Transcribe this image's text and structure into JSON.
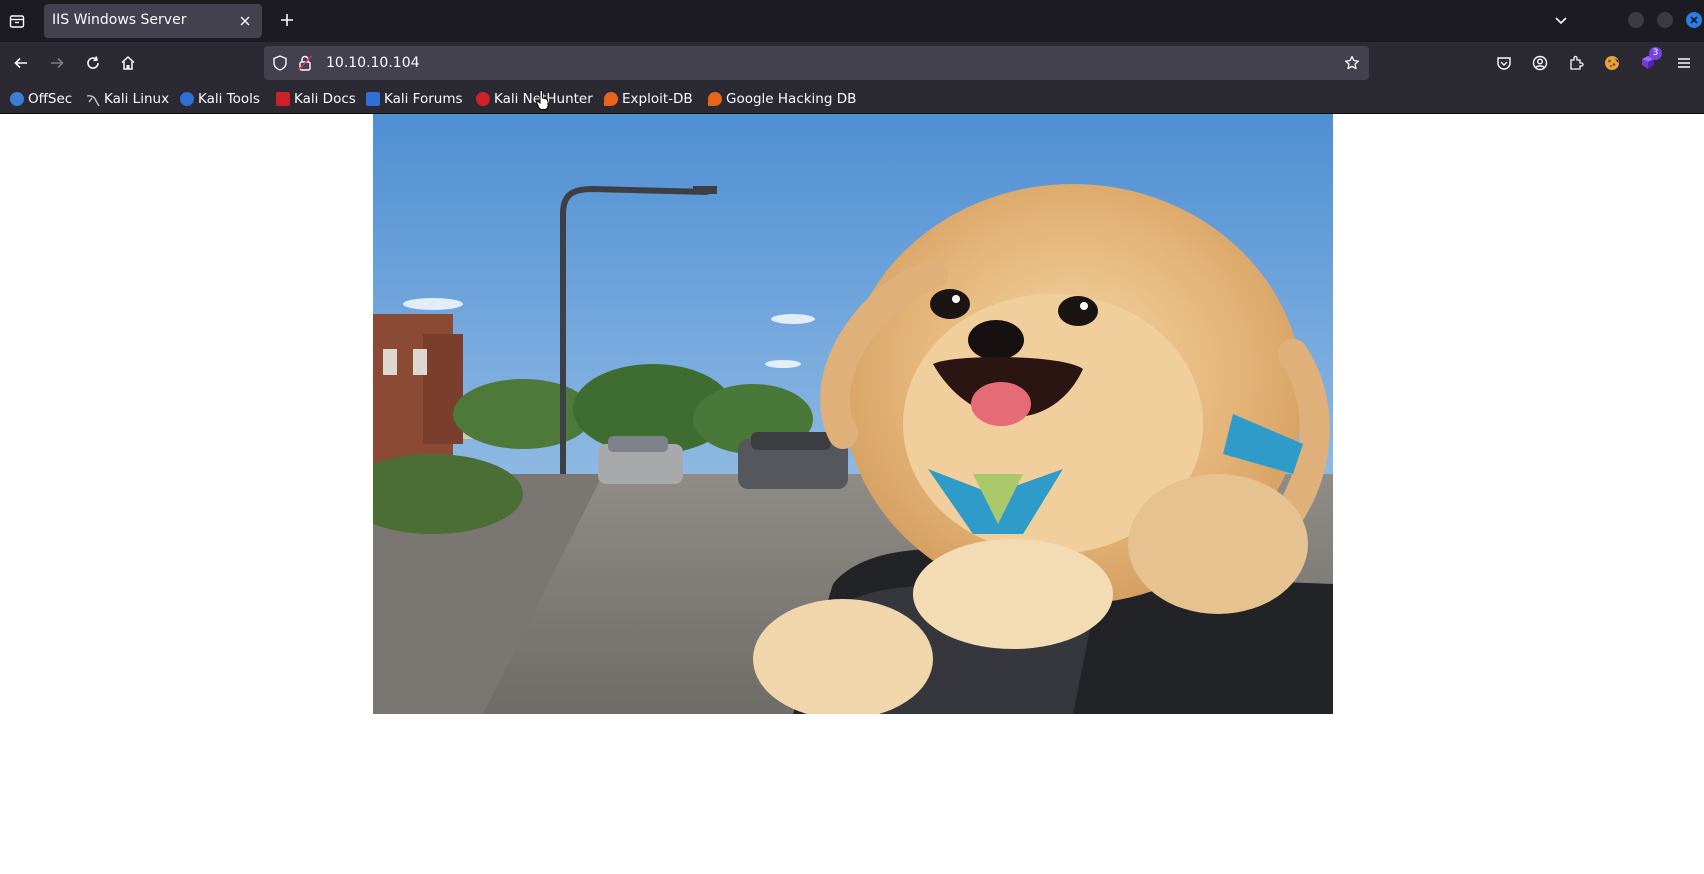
{
  "browser": {
    "tab": {
      "title": "IIS Windows Server"
    },
    "address": {
      "url": "10.10.10.104"
    },
    "toolbar": {
      "extension_badge": "3"
    },
    "bookmarks": [
      {
        "label": "OffSec",
        "icon": "offsec-icon",
        "color": "#3b7dd8"
      },
      {
        "label": "Kali Linux",
        "icon": "kali-dragon-icon",
        "color": "#cccccc"
      },
      {
        "label": "Kali Tools",
        "icon": "kali-tools-icon",
        "color": "#2f6fd6"
      },
      {
        "label": "Kali Docs",
        "icon": "kali-docs-icon",
        "color": "#d0202a"
      },
      {
        "label": "Kali Forums",
        "icon": "kali-forums-icon",
        "color": "#2f6fd6"
      },
      {
        "label": "Kali NetHunter",
        "icon": "kali-nethunter-icon",
        "color": "#d0202a"
      },
      {
        "label": "Exploit-DB",
        "icon": "exploit-db-icon",
        "color": "#e8641b"
      },
      {
        "label": "Google Hacking DB",
        "icon": "ghdb-icon",
        "color": "#e8641b"
      }
    ]
  },
  "page": {
    "image": {
      "subject": "pomeranian-dog-photo"
    }
  },
  "colors": {
    "tabbar_bg": "#1c1b22",
    "toolbar_bg": "#2b2a33",
    "urlbar_bg": "#42414d",
    "accent": "#0a84ff"
  }
}
